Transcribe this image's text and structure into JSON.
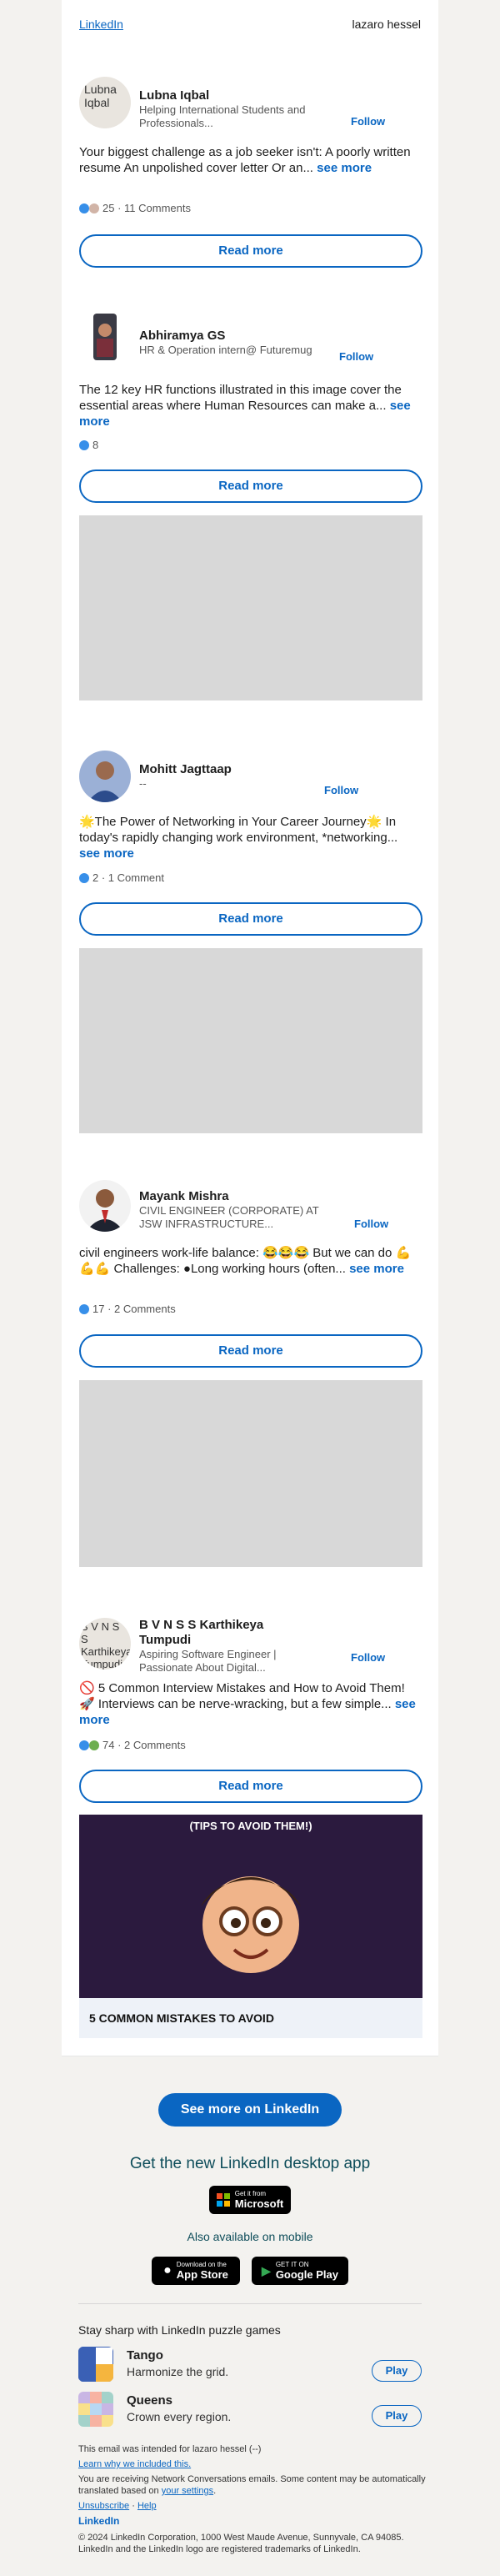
{
  "header": {
    "logo_alt": "LinkedIn",
    "user": "lazaro hessel"
  },
  "posts": [
    {
      "avatar_text": "Lubna Iqbal",
      "name": "Lubna Iqbal",
      "headline": "Helping International Students and Professionals...",
      "follow": "Follow",
      "text": "Your biggest challenge as a job seeker isn't: A poorly written resume An unpolished cover letter Or an...",
      "see_more": "see more",
      "stats": "25 · 11 Comments",
      "read_more": "Read more"
    },
    {
      "name": "Abhiramya GS",
      "headline": "HR & Operation intern@ Futuremug",
      "follow": "Follow",
      "text": "The 12 key HR functions illustrated in this image cover the essential areas where Human Resources can make a...",
      "see_more": "see more",
      "stats": "8",
      "read_more": "Read more"
    },
    {
      "name": "Mohitt Jagttaap",
      "headline": "--",
      "follow": "Follow",
      "text": "🌟The Power of Networking in Your Career Journey🌟 In today's rapidly changing work environment, *networking...",
      "see_more": "see more",
      "stats": "2 · 1 Comment",
      "read_more": "Read more"
    },
    {
      "name": "Mayank Mishra",
      "headline": "CIVIL ENGINEER (CORPORATE) AT JSW INFRASTRUCTURE...",
      "follow": "Follow",
      "text": "civil engineers work-life balance: 😂😂😂 But we can do 💪💪💪 Challenges: ●Long working hours (often...",
      "see_more": "see more",
      "stats": "17 · 2 Comments",
      "read_more": "Read more"
    },
    {
      "avatar_text": "B V N S S Karthikeya Tumpudi",
      "name": "B V N S S Karthikeya Tumpudi",
      "headline": "Aspiring Software Engineer | Passionate About Digital...",
      "follow": "Follow",
      "text": "🚫 5 Common Interview Mistakes and How to Avoid Them! 🚀 Interviews can be nerve-wracking, but a few simple...",
      "see_more": "see more",
      "stats": "74 · 2 Comments",
      "read_more": "Read more",
      "image_top": "(TIPS TO AVOID THEM!)",
      "image_caption": "5 COMMON MISTAKES TO AVOID"
    }
  ],
  "see_more_button": "See more on LinkedIn",
  "desktop_app": {
    "title": "Get the new LinkedIn desktop app",
    "microsoft_small": "Get it from",
    "microsoft": "Microsoft",
    "mobile": "Also available on mobile",
    "appstore_small": "Download on the",
    "appstore": "App Store",
    "gplay_small": "GET IT ON",
    "gplay": "Google Play"
  },
  "games": {
    "heading": "Stay sharp with LinkedIn puzzle games",
    "items": [
      {
        "title": "Tango",
        "subtitle": "Harmonize the grid.",
        "play": "Play"
      },
      {
        "title": "Queens",
        "subtitle": "Crown every region.",
        "play": "Play"
      }
    ]
  },
  "footer": {
    "intended": "This email was intended for lazaro hessel (--)",
    "learn": "Learn why we included this.",
    "receiving": "You are receiving Network Conversations emails. Some content may be automatically translated based on",
    "settings": "your settings",
    "unsubscribe": "Unsubscribe",
    "sep": "·",
    "help": "Help",
    "logo": "LinkedIn",
    "copyright": "© 2024 LinkedIn Corporation, 1000 West Maude Avenue, Sunnyvale, CA 94085. LinkedIn and the LinkedIn logo are registered trademarks of LinkedIn."
  }
}
